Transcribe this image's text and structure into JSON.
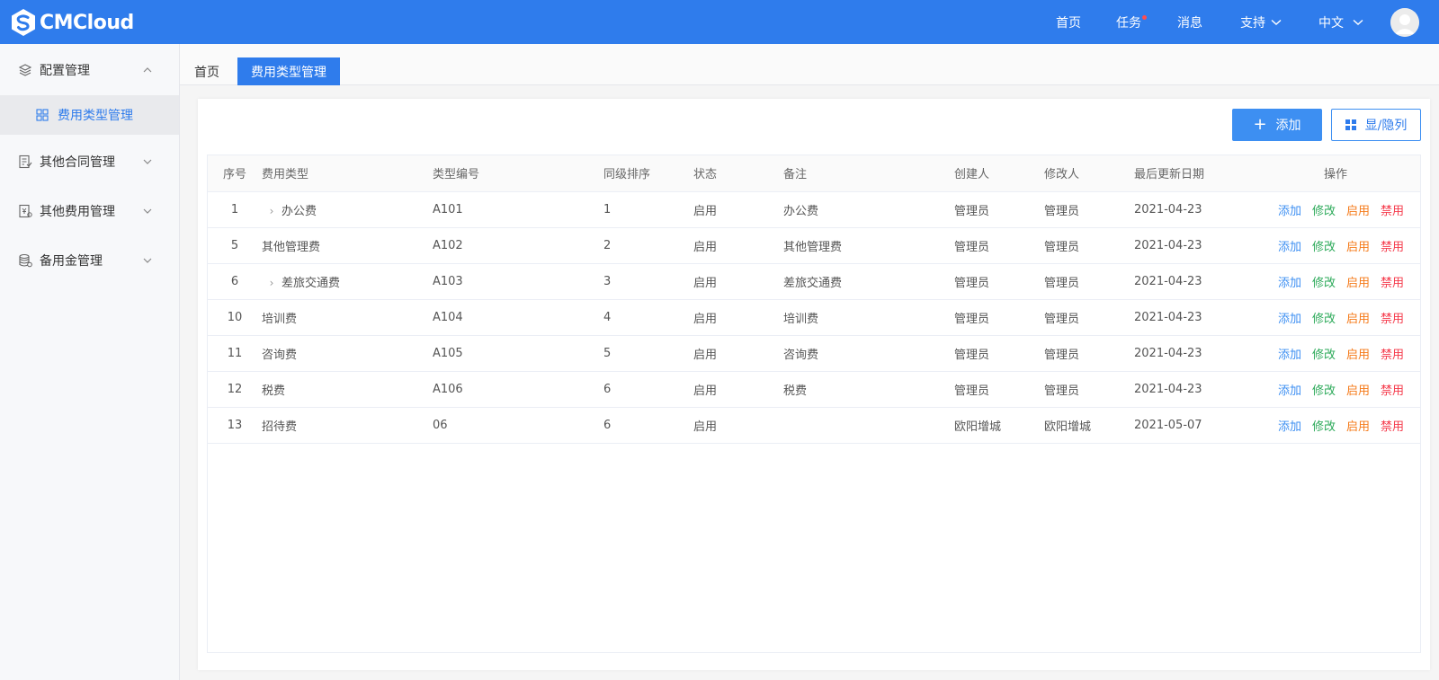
{
  "header": {
    "brand": "CMCloud",
    "nav": {
      "home": "首页",
      "tasks": "任务",
      "messages": "消息",
      "support": "支持",
      "language": "中文"
    },
    "colors": {
      "primary": "#2f7cec",
      "notify_dot": "#ff4d4f"
    }
  },
  "sidebar": {
    "groups": [
      {
        "label": "配置管理",
        "icon": "layers-icon",
        "expanded": true
      },
      {
        "label": "其他合同管理",
        "icon": "contract-icon",
        "expanded": false
      },
      {
        "label": "其他费用管理",
        "icon": "expense-icon",
        "expanded": false
      },
      {
        "label": "备用金管理",
        "icon": "database-icon",
        "expanded": false
      }
    ],
    "active_sub": {
      "label": "费用类型管理",
      "icon": "grid-icon"
    }
  },
  "tabs": {
    "home": "首页",
    "active": "费用类型管理"
  },
  "toolbar": {
    "add_label": "添加",
    "columns_label": "显/隐列"
  },
  "table": {
    "headers": [
      "序号",
      "费用类型",
      "类型编号",
      "同级排序",
      "状态",
      "备注",
      "创建人",
      "修改人",
      "最后更新日期",
      "操作"
    ],
    "actions": [
      "添加",
      "修改",
      "启用",
      "禁用"
    ],
    "rows": [
      {
        "idx": "1",
        "type": "办公费",
        "code": "A101",
        "order": "1",
        "status": "启用",
        "remark": "办公费",
        "creator": "管理员",
        "modifier": "管理员",
        "date": "2021-04-23",
        "expandable": true
      },
      {
        "idx": "5",
        "type": "其他管理费",
        "code": "A102",
        "order": "2",
        "status": "启用",
        "remark": "其他管理费",
        "creator": "管理员",
        "modifier": "管理员",
        "date": "2021-04-23",
        "expandable": false
      },
      {
        "idx": "6",
        "type": "差旅交通费",
        "code": "A103",
        "order": "3",
        "status": "启用",
        "remark": "差旅交通费",
        "creator": "管理员",
        "modifier": "管理员",
        "date": "2021-04-23",
        "expandable": true
      },
      {
        "idx": "10",
        "type": "培训费",
        "code": "A104",
        "order": "4",
        "status": "启用",
        "remark": "培训费",
        "creator": "管理员",
        "modifier": "管理员",
        "date": "2021-04-23",
        "expandable": false
      },
      {
        "idx": "11",
        "type": "咨询费",
        "code": "A105",
        "order": "5",
        "status": "启用",
        "remark": "咨询费",
        "creator": "管理员",
        "modifier": "管理员",
        "date": "2021-04-23",
        "expandable": false
      },
      {
        "idx": "12",
        "type": "税费",
        "code": "A106",
        "order": "6",
        "status": "启用",
        "remark": "税费",
        "creator": "管理员",
        "modifier": "管理员",
        "date": "2021-04-23",
        "expandable": false
      },
      {
        "idx": "13",
        "type": "招待费",
        "code": "06",
        "order": "6",
        "status": "启用",
        "remark": "",
        "creator": "欧阳增城",
        "modifier": "欧阳增城",
        "date": "2021-05-07",
        "expandable": false
      }
    ]
  }
}
